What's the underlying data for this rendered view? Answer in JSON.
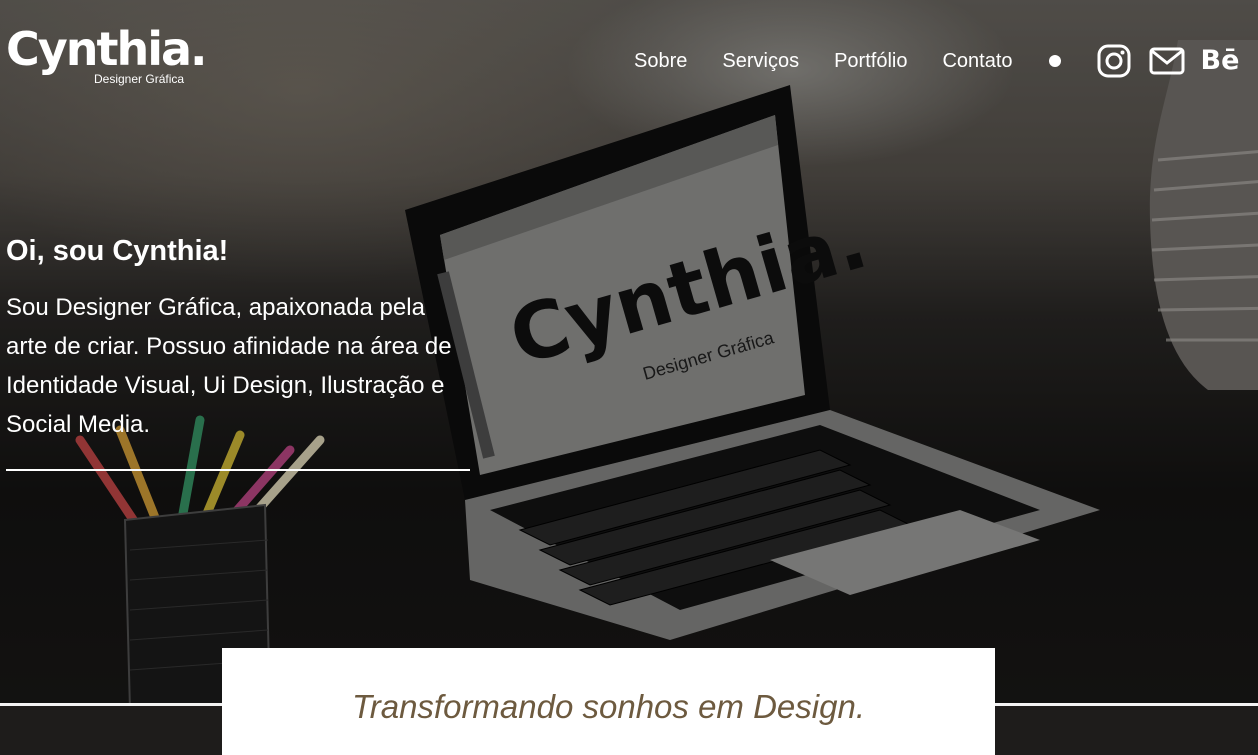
{
  "brand": {
    "name": "Cynthia.",
    "subtitle": "Designer Gráfica"
  },
  "nav": {
    "items": [
      {
        "label": "Sobre"
      },
      {
        "label": "Serviços"
      },
      {
        "label": "Portfólio"
      },
      {
        "label": "Contato"
      }
    ],
    "socials": {
      "behance_label": "Bē"
    }
  },
  "hero": {
    "heading": "Oi, sou Cynthia!",
    "body": "Sou Designer Gráfica, apaixonada pela arte de criar. Possuo afinidade na área de Identidade Visual, Ui Design, Ilustração e Social Media.",
    "screen_logo": "Cynthia.",
    "screen_subtitle": "Designer Gráfica"
  },
  "tagline": "Transformando sonhos em Design.",
  "colors": {
    "tagline": "#6d5a3f",
    "band": "#1e1c1b",
    "text": "#ffffff"
  },
  "icons": [
    "instagram-icon",
    "mail-icon",
    "behance-icon",
    "theme-dot-icon"
  ]
}
